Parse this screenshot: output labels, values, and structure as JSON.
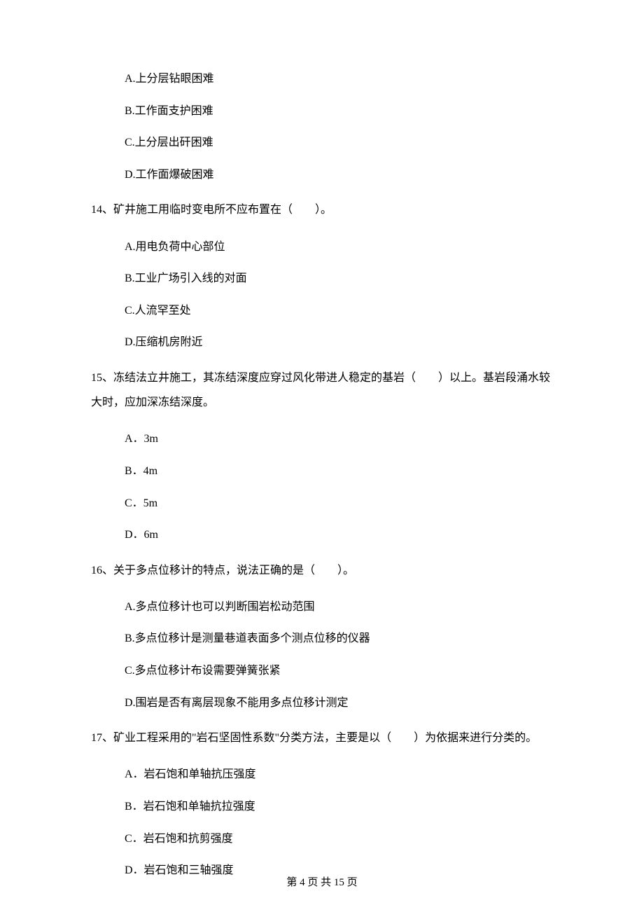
{
  "q13": {
    "options": {
      "A": "A.上分层钻眼困难",
      "B": "B.工作面支护困难",
      "C": "C.上分层出矸困难",
      "D": "D.工作面爆破困难"
    }
  },
  "q14": {
    "stem": "14、矿井施工用临时变电所不应布置在（　　）。",
    "options": {
      "A": "A.用电负荷中心部位",
      "B": "B.工业广场引入线的对面",
      "C": "C.人流罕至处",
      "D": "D.压缩机房附近"
    }
  },
  "q15": {
    "stem": "15、冻结法立井施工，其冻结深度应穿过风化带进人稳定的基岩（　　）以上。基岩段涌水较大时，应加深冻结深度。",
    "options": {
      "A": "A．3m",
      "B": "B．4m",
      "C": "C．5m",
      "D": "D．6m"
    }
  },
  "q16": {
    "stem": "16、关于多点位移计的特点，说法正确的是（　　）。",
    "options": {
      "A": "A.多点位移计也可以判断围岩松动范围",
      "B": "B.多点位移计是测量巷道表面多个测点位移的仪器",
      "C": "C.多点位移计布设需要弹簧张紧",
      "D": "D.围岩是否有离层现象不能用多点位移计测定"
    }
  },
  "q17": {
    "stem": "17、矿业工程采用的\"岩石坚固性系数\"分类方法，主要是以（　　）为依据来进行分类的。",
    "options": {
      "A": "A．岩石饱和单轴抗压强度",
      "B": "B．岩石饱和单轴抗拉强度",
      "C": "C．岩石饱和抗剪强度",
      "D": "D．岩石饱和三轴强度"
    }
  },
  "footer": "第 4 页 共 15 页"
}
